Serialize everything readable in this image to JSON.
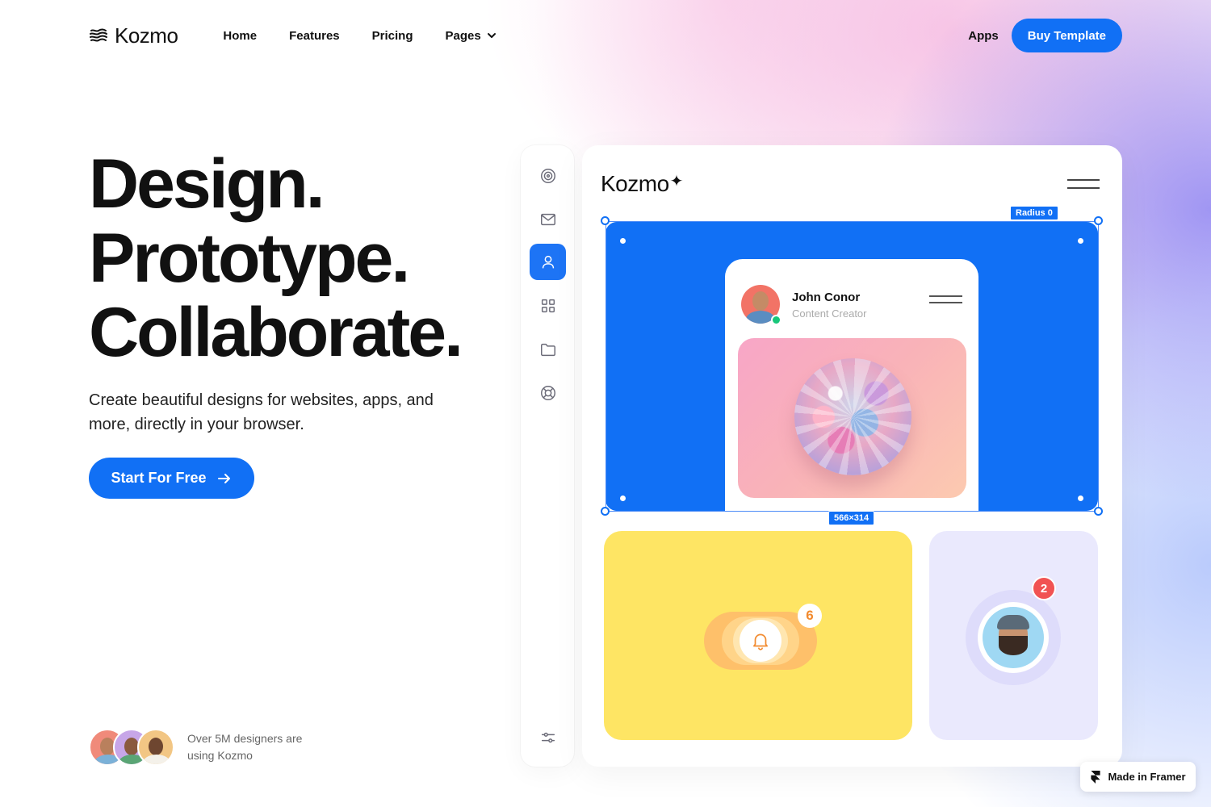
{
  "nav": {
    "brand": "Kozmo",
    "links": [
      "Home",
      "Features",
      "Pricing",
      "Pages"
    ],
    "apps_label": "Apps",
    "buy_label": "Buy Template"
  },
  "hero": {
    "title_lines": [
      "Design.",
      "Prototype.",
      "Collaborate."
    ],
    "subtitle": "Create beautiful designs for websites, apps, and more, directly in your browser.",
    "cta_label": "Start For Free",
    "social_proof": "Over 5M designers are using Kozmo"
  },
  "sidebar": {
    "icons": [
      "target-icon",
      "mail-icon",
      "user-icon",
      "grid-icon",
      "folder-icon",
      "lifebuoy-icon",
      "sliders-icon"
    ],
    "active_index": 2
  },
  "preview": {
    "brand": "Kozmo",
    "brand_star": "✦",
    "radius_tag": "Radius 0",
    "size_tag": "566×314",
    "profile_name": "John Conor",
    "profile_role": "Content Creator",
    "notification_count": "6",
    "avatar_badge_count": "2"
  },
  "badge": {
    "label": "Made in Framer"
  },
  "colors": {
    "accent": "#1170f5",
    "yellow_card": "#fee564",
    "lavender_card": "#eae9fd",
    "online": "#18c77a",
    "alert": "#f15353"
  }
}
